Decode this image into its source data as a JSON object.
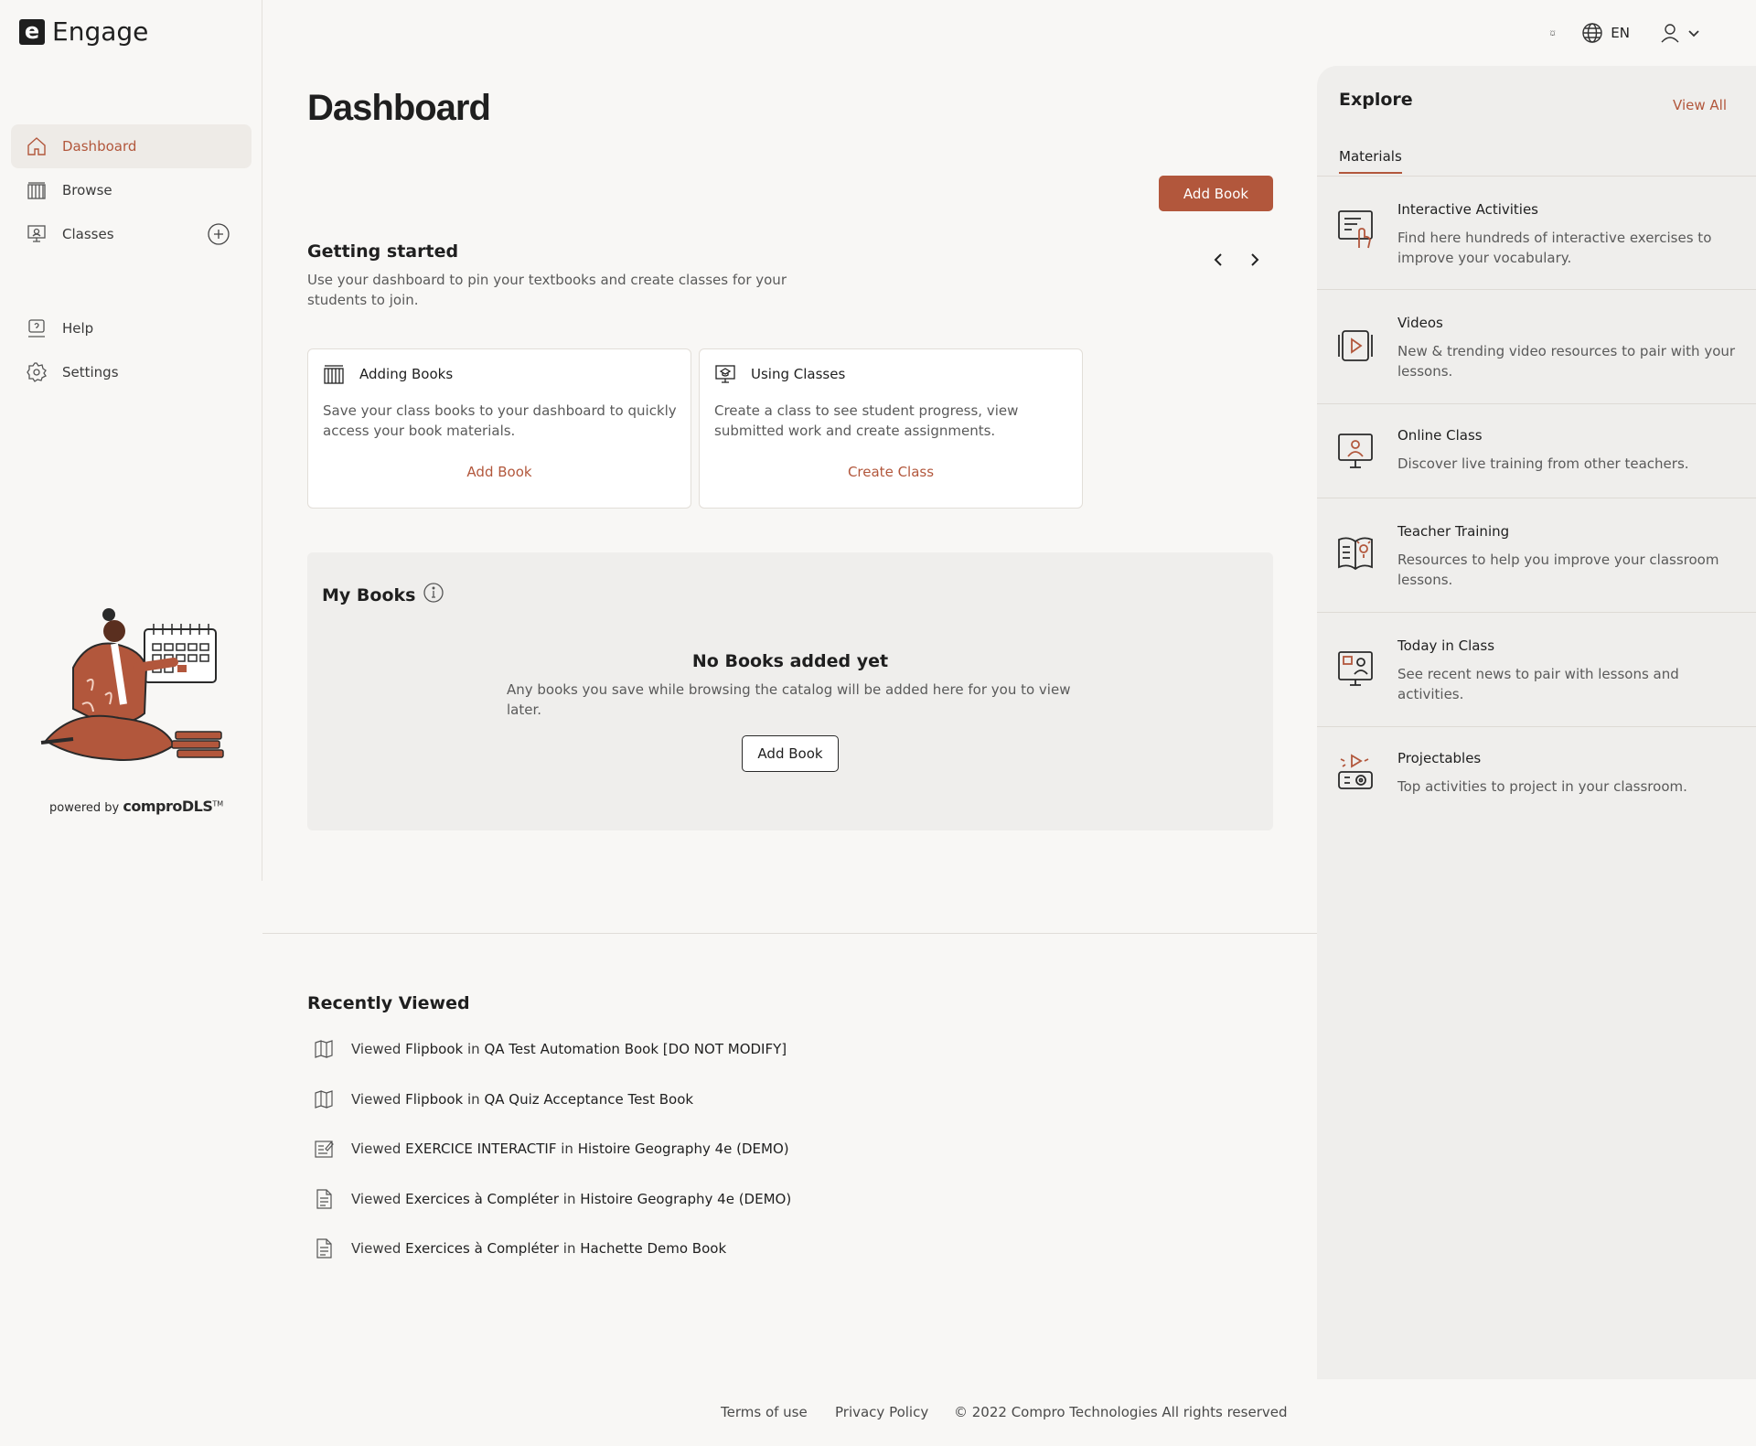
{
  "app": {
    "brand_letter": "e",
    "brand_name": "Engage",
    "language": "EN"
  },
  "sidebar": {
    "items": [
      {
        "label": "Dashboard",
        "icon": "home-icon"
      },
      {
        "label": "Browse",
        "icon": "books-icon"
      },
      {
        "label": "Classes",
        "icon": "classroom-icon"
      },
      {
        "label": "Help",
        "icon": "help-icon"
      },
      {
        "label": "Settings",
        "icon": "gear-icon"
      }
    ],
    "powered_by": "powered by",
    "powered_brand": "comproDLS",
    "trademark": "TM"
  },
  "main": {
    "title": "Dashboard",
    "add_book_label": "Add Book",
    "getting_started": {
      "title": "Getting started",
      "subtitle": "Use your dashboard to pin your textbooks and create classes for your students to join.",
      "cards": [
        {
          "title": "Adding Books",
          "description": "Save your class books to your dashboard to quickly access your book materials.",
          "link": "Add Book"
        },
        {
          "title": "Using Classes",
          "description": "Create a class to see student progress, view submitted work and create assignments.",
          "link": "Create Class"
        }
      ]
    },
    "my_books": {
      "title": "My Books",
      "empty_title": "No Books added yet",
      "empty_desc": "Any books you save while browsing the catalog will be added here for you to view later.",
      "button": "Add Book"
    },
    "recently_viewed": {
      "title": "Recently Viewed",
      "viewed_word": "Viewed",
      "in_word": "in",
      "items": [
        {
          "type": "Flipbook",
          "book": "QA Test Automation Book [DO NOT MODIFY]",
          "icon": "book-open-icon"
        },
        {
          "type": "Flipbook",
          "book": "QA Quiz Acceptance Test Book",
          "icon": "book-open-icon"
        },
        {
          "type": "EXERCICE INTERACTIF",
          "book": "Histoire Geography 4e (DEMO)",
          "icon": "edit-doc-icon"
        },
        {
          "type": "Exercices à Compléter",
          "book": "Histoire Geography 4e (DEMO)",
          "icon": "document-icon"
        },
        {
          "type": "Exercices à Compléter",
          "book": "Hachette Demo Book",
          "icon": "document-icon"
        }
      ]
    }
  },
  "explore": {
    "title": "Explore",
    "view_all": "View All",
    "tab": "Materials",
    "items": [
      {
        "title": "Interactive Activities",
        "description": "Find here hundreds of interactive exercises to improve your vocabulary."
      },
      {
        "title": "Videos",
        "description": "New & trending video resources to pair with your lessons."
      },
      {
        "title": "Online Class",
        "description": "Discover live training from other teachers."
      },
      {
        "title": "Teacher Training",
        "description": "Resources to help you improve your classroom lessons."
      },
      {
        "title": "Today in Class",
        "description": "See recent news to pair with lessons and activities."
      },
      {
        "title": "Projectables",
        "description": "Top activities to project in your classroom."
      }
    ]
  },
  "footer": {
    "terms": "Terms of use",
    "privacy": "Privacy Policy",
    "copyright": "© 2022 Compro Technologies All rights reserved"
  },
  "colors": {
    "accent": "#b2573c",
    "background": "#f8f7f5",
    "panel": "#efeeec"
  }
}
